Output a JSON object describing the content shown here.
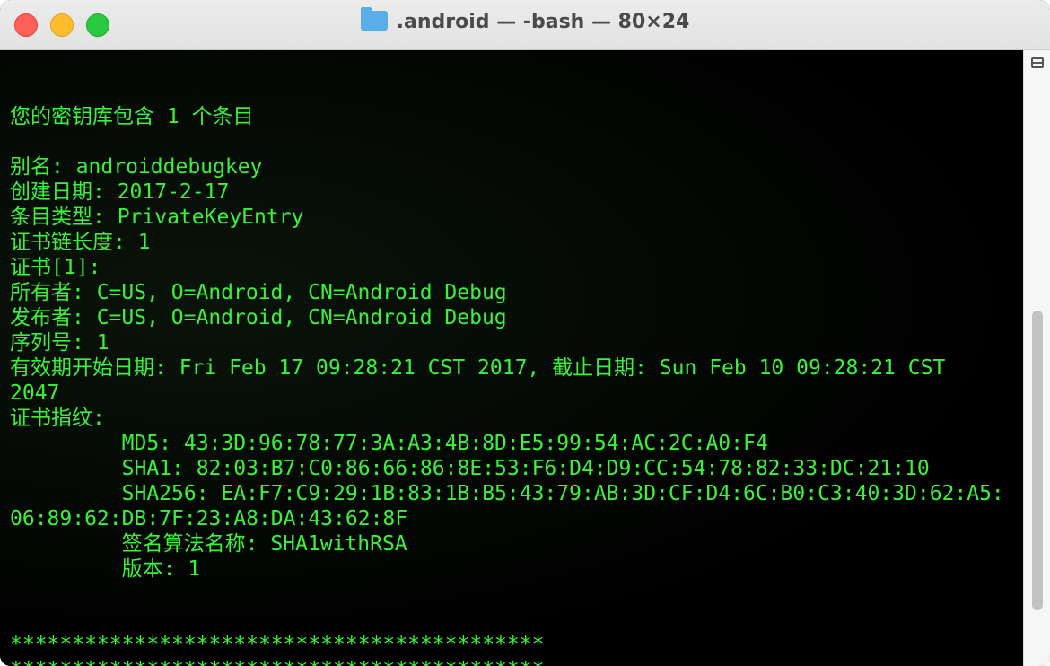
{
  "window": {
    "title": ".android — -bash — 80×24",
    "icon": "folder-icon"
  },
  "terminal": {
    "lines": [
      "",
      "您的密钥库包含 1 个条目",
      "",
      "别名: androiddebugkey",
      "创建日期: 2017-2-17",
      "条目类型: PrivateKeyEntry",
      "证书链长度: 1",
      "证书[1]:",
      "所有者: C=US, O=Android, CN=Android Debug",
      "发布者: C=US, O=Android, CN=Android Debug",
      "序列号: 1",
      "有效期开始日期: Fri Feb 17 09:28:21 CST 2017, 截止日期: Sun Feb 10 09:28:21 CST",
      "2047",
      "证书指纹:",
      "\t MD5: 43:3D:96:78:77:3A:A3:4B:8D:E5:99:54:AC:2C:A0:F4",
      "\t SHA1: 82:03:B7:C0:86:66:86:8E:53:F6:D4:D9:CC:54:78:82:33:DC:21:10",
      "\t SHA256: EA:F7:C9:29:1B:83:1B:B5:43:79:AB:3D:CF:D4:6C:B0:C3:40:3D:62:A5:",
      "06:89:62:DB:7F:23:A8:DA:43:62:8F",
      "\t 签名算法名称: SHA1withRSA",
      "\t 版本: 1",
      "",
      "",
      "*******************************************",
      "*******************************************"
    ]
  },
  "colors": {
    "text": "#3af23a",
    "background": "#000000"
  }
}
